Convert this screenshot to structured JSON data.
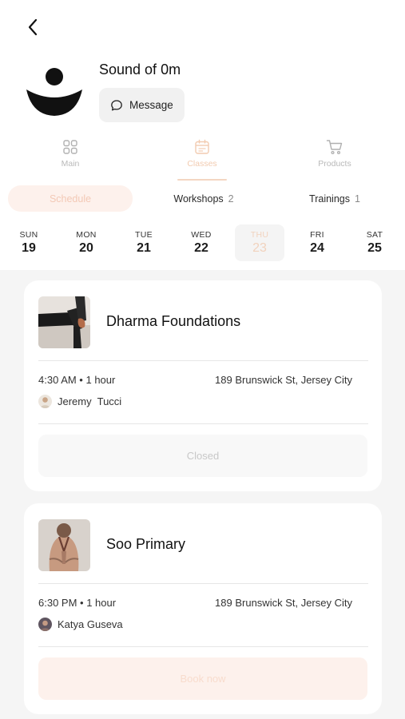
{
  "studio": {
    "name": "Sound of 0m",
    "message_label": "Message"
  },
  "tabs": [
    {
      "label": "Main",
      "icon": "grid-icon",
      "active": false
    },
    {
      "label": "Classes",
      "icon": "calendar-icon",
      "active": true
    },
    {
      "label": "Products",
      "icon": "cart-icon",
      "active": false
    }
  ],
  "segments": [
    {
      "label": "Schedule",
      "count": "",
      "active": true
    },
    {
      "label": "Workshops",
      "count": "2",
      "active": false
    },
    {
      "label": "Trainings",
      "count": "1",
      "active": false
    }
  ],
  "days": [
    {
      "name": "SUN",
      "date": "19",
      "selected": false
    },
    {
      "name": "MON",
      "date": "20",
      "selected": false
    },
    {
      "name": "TUE",
      "date": "21",
      "selected": false
    },
    {
      "name": "WED",
      "date": "22",
      "selected": false
    },
    {
      "name": "THU",
      "date": "23",
      "selected": true
    },
    {
      "name": "FRI",
      "date": "24",
      "selected": false
    },
    {
      "name": "SAT",
      "date": "25",
      "selected": false
    }
  ],
  "classes": [
    {
      "title": "Dharma Foundations",
      "time": "4:30 AM • 1 hour",
      "address": "189 Brunswick St, Jersey City",
      "instructor": "Jeremy  Tucci",
      "action": "Closed",
      "action_type": "closed"
    },
    {
      "title": "Soo Primary",
      "time": "6:30 PM • 1 hour",
      "address": "189 Brunswick St, Jersey City",
      "instructor": "Katya Guseva",
      "action": "Book now",
      "action_type": "book"
    }
  ],
  "colors": {
    "accent": "#f2cbb0",
    "accent_bg": "#fdf1ec",
    "list_bg": "#f5f5f5"
  }
}
